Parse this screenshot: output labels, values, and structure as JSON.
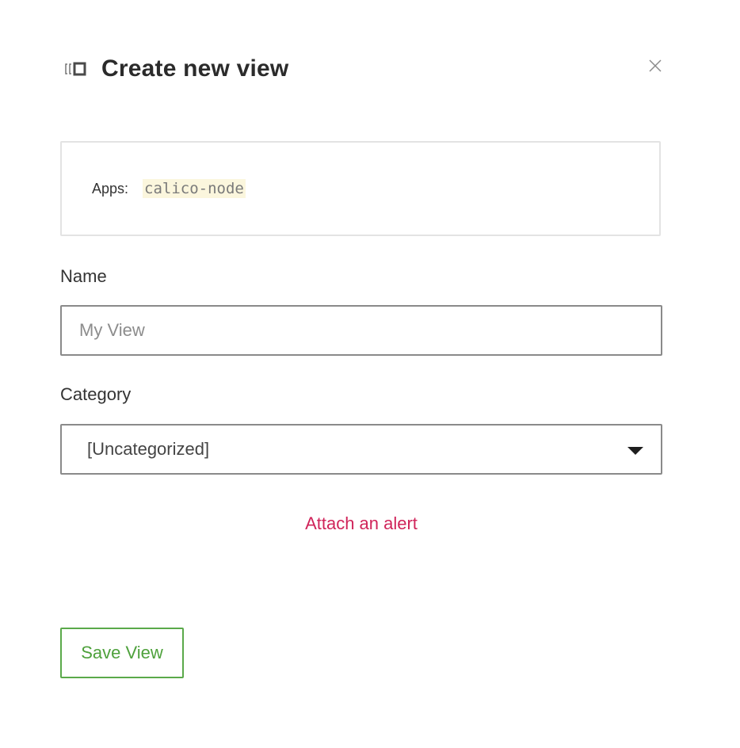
{
  "dialog": {
    "title": "Create new view",
    "icon": "view-icon",
    "close_icon": "close-icon"
  },
  "filter": {
    "label": "Apps:",
    "value": "calico-node"
  },
  "name_field": {
    "label": "Name",
    "placeholder": "My View",
    "value": ""
  },
  "category_field": {
    "label": "Category",
    "selected": "[Uncategorized]",
    "caret_icon": "caret-down-icon"
  },
  "alert_link": "Attach an alert",
  "save_button": "Save View",
  "colors": {
    "alert_link": "#d0245a",
    "save_button": "#4ea13c",
    "chip_background": "#fbf6dd"
  }
}
